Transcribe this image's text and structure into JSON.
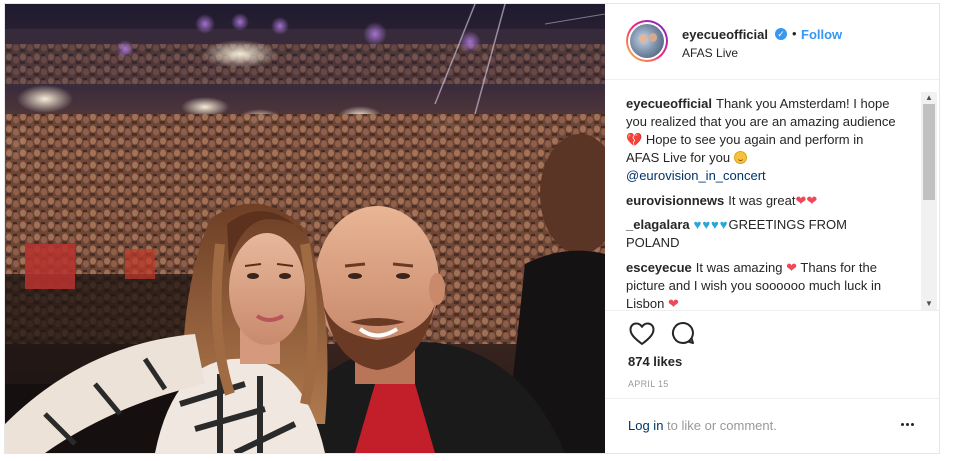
{
  "post": {
    "username": "eyecueofficial",
    "verified_icon": "verified-badge-icon",
    "separator": "•",
    "follow_label": "Follow",
    "location": "AFAS Live",
    "photo_alt": "selfie-on-stage-photo"
  },
  "comments": [
    {
      "user": "eyecueofficial",
      "text_1": "Thank you Amsterdam! I hope you realized that you are an amazing audience",
      "text_2": "Hope to see you again and perform in AFAS Live for you",
      "mention": "@eurovision_in_concert"
    },
    {
      "user": "eurovisionnews",
      "text": "It was great"
    },
    {
      "user": "_elagalara",
      "text": "GREETINGS FROM POLAND"
    },
    {
      "user": "esceyecue",
      "text": "It was amazing",
      "text_2": "Thans for the picture and I wish you soooooo much luck in Lisbon"
    }
  ],
  "actions": {
    "likes": "874 likes",
    "date": "APRIL 15"
  },
  "footer": {
    "login_link": "Log in",
    "login_rest": "to like or comment."
  },
  "colors": {
    "accent": "#3897f0",
    "heart": "#ed4956",
    "link": "#003569",
    "muted": "#999999"
  }
}
